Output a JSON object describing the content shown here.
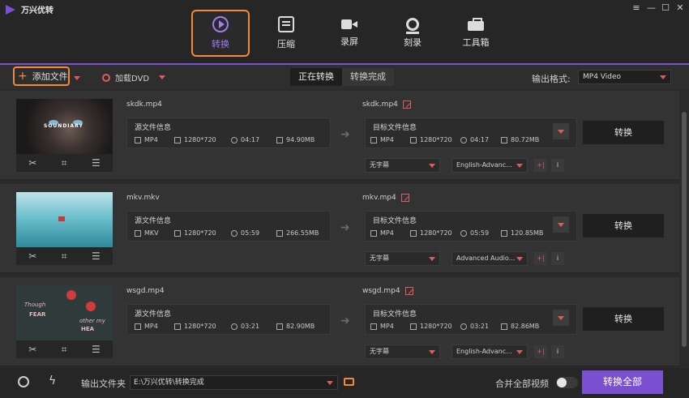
{
  "app": {
    "title": "万兴优转"
  },
  "window": {
    "minimize": "—",
    "restore": "☐",
    "close": "✕",
    "menu": "≡"
  },
  "nav": {
    "tabs": [
      {
        "label": "转换",
        "icon": "convert-icon",
        "active": true
      },
      {
        "label": "压缩",
        "icon": "compress-icon"
      },
      {
        "label": "录屏",
        "icon": "record-icon"
      },
      {
        "label": "刻录",
        "icon": "burn-icon"
      },
      {
        "label": "工具箱",
        "icon": "toolbox-icon"
      }
    ]
  },
  "toolbar": {
    "add_file": "添加文件",
    "load_dvd": "加载DVD",
    "segments": [
      "正在转换",
      "转换完成"
    ],
    "output_format_label": "输出格式:",
    "output_format_value": "MP4 Video"
  },
  "files": [
    {
      "source_name": "skdk.mp4",
      "source_title": "源文件信息",
      "source": {
        "format": "MP4",
        "resolution": "1280*720",
        "duration": "04:17",
        "size": "94.90MB"
      },
      "target_name": "skdk.mp4",
      "target_title": "目标文件信息",
      "target": {
        "format": "MP4",
        "resolution": "1280*720",
        "duration": "04:17",
        "size": "80.72MB"
      },
      "subtitle": "无字幕",
      "audio": "English-Advanc...",
      "convert": "转换"
    },
    {
      "source_name": "mkv.mkv",
      "source_title": "源文件信息",
      "source": {
        "format": "MKV",
        "resolution": "1280*720",
        "duration": "05:59",
        "size": "266.55MB"
      },
      "target_name": "mkv.mp4",
      "target_title": "目标文件信息",
      "target": {
        "format": "MP4",
        "resolution": "1280*720",
        "duration": "05:59",
        "size": "120.85MB"
      },
      "subtitle": "无字幕",
      "audio": "Advanced Audio...",
      "convert": "转换"
    },
    {
      "source_name": "wsgd.mp4",
      "source_title": "源文件信息",
      "source": {
        "format": "MP4",
        "resolution": "1280*720",
        "duration": "03:21",
        "size": "82.90MB"
      },
      "target_name": "wsgd.mp4",
      "target_title": "目标文件信息",
      "target": {
        "format": "MP4",
        "resolution": "1280*720",
        "duration": "03:21",
        "size": "82.86MB"
      },
      "subtitle": "无字幕",
      "audio": "English-Advanc...",
      "convert": "转换"
    }
  ],
  "thumb_text": {
    "file1_band": "SOUNDIARY",
    "file3_line1": "Though",
    "file3_line2": "FEAR",
    "file3_line3": "other my",
    "file3_line4": "HEA"
  },
  "bottom": {
    "output_folder_label": "输出文件夹",
    "output_folder_path": "E:\\万兴优转\\转换完成",
    "merge_label": "合并全部视频",
    "convert_all": "转换全部"
  },
  "colors": {
    "accent": "#7a4fd0",
    "highlight": "#f28a3c",
    "danger": "#e05c5c"
  }
}
